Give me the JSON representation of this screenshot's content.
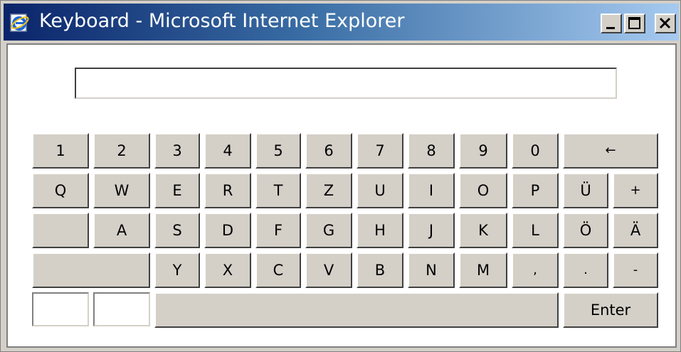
{
  "window": {
    "title": "Keyboard - Microsoft Internet Explorer",
    "icon": "internet-explorer-icon",
    "controls": [
      "minimize-icon",
      "maximize-icon",
      "close-icon"
    ]
  },
  "input": {
    "value": "",
    "placeholder": ""
  },
  "keyboard": {
    "row1": [
      "1",
      "2",
      "3",
      "4",
      "5",
      "6",
      "7",
      "8",
      "9",
      "0",
      "←"
    ],
    "row2": [
      "Q",
      "W",
      "E",
      "R",
      "T",
      "Z",
      "U",
      "I",
      "O",
      "P",
      "Ü",
      "+"
    ],
    "row3": [
      "",
      "A",
      "S",
      "D",
      "F",
      "G",
      "H",
      "J",
      "K",
      "L",
      "Ö",
      "Ä"
    ],
    "row4": [
      "",
      "Y",
      "X",
      "C",
      "V",
      "B",
      "N",
      "M",
      ",",
      ".",
      "-"
    ],
    "row5": {
      "blank_left": "",
      "blank_right": "",
      "space": "",
      "enter": "Enter"
    }
  },
  "colors": {
    "face": "#d4d0c8",
    "title_start": "#0a246a",
    "title_end": "#a6caf0"
  }
}
